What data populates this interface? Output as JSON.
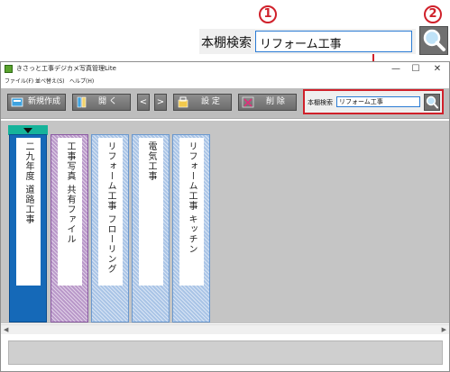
{
  "callout": {
    "marker_1": "1",
    "marker_2": "2",
    "search_label": "本棚検索",
    "search_value": "リフォーム工事"
  },
  "window": {
    "title": "きさっと工事デジカメ写真管理Lite",
    "controls": {
      "minimize": "—",
      "maximize": "☐",
      "close": "✕"
    }
  },
  "menu": [
    {
      "label": "ファイル(F)"
    },
    {
      "label": "並べ替え(S)"
    },
    {
      "label": "ヘルプ(H)"
    }
  ],
  "toolbar": {
    "new_label": "新規作成",
    "open_label": "開 く",
    "prev_label": "<",
    "next_label": ">",
    "settings_label": "設 定",
    "delete_label": "削 除",
    "search_label": "本棚検索",
    "search_value": "リフォーム工事"
  },
  "books": [
    {
      "title": "二九年度 道路工事",
      "state": "selected",
      "color": "#1569b8"
    },
    {
      "title": "工事写真 共有ファイル",
      "state": "shared",
      "color": "#b998c9"
    },
    {
      "title": "リフォーム工事 フローリング",
      "state": "normal",
      "color": "#a9c4e6"
    },
    {
      "title": "電気工事",
      "state": "normal",
      "color": "#a9c4e6"
    },
    {
      "title": "リフォーム工事 キッチン",
      "state": "normal",
      "color": "#a9c4e6"
    }
  ],
  "colors": {
    "accent_red": "#d0202a",
    "selected_tab": "#16b39a",
    "toolbar_bg": "#bdbdbd",
    "shelf_bg": "#c5c5c5"
  },
  "icons": {
    "search": "magnifier-icon",
    "new": "new-book-icon",
    "open": "open-book-icon",
    "settings": "settings-icon",
    "delete": "delete-icon"
  }
}
